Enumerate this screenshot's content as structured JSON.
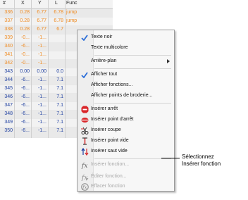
{
  "grid": {
    "headers": [
      "#",
      "X",
      "Y",
      "L",
      "Func"
    ],
    "rows": [
      {
        "cells": [
          "336",
          "0.28",
          "6.77",
          "6.78",
          "jump"
        ],
        "color": "orange"
      },
      {
        "cells": [
          "337",
          "0.28",
          "6.77",
          "6.78",
          "jump"
        ],
        "color": "orange"
      },
      {
        "cells": [
          "338",
          "0.28",
          "6.77",
          "6.7",
          ""
        ],
        "color": "orange"
      },
      {
        "cells": [
          "339",
          "-0...",
          "-1...",
          "",
          ""
        ],
        "color": "orange"
      },
      {
        "cells": [
          "340",
          "-6...",
          "-1...",
          "",
          ""
        ],
        "color": "orange"
      },
      {
        "cells": [
          "341",
          "-0...",
          "-1...",
          "",
          ""
        ],
        "color": "orange"
      },
      {
        "cells": [
          "342",
          "-0...",
          "-1...",
          "",
          ""
        ],
        "color": "orange"
      },
      {
        "cells": [
          "343",
          "0.00",
          "0.00",
          "0.0",
          ""
        ],
        "color": "blue"
      },
      {
        "cells": [
          "344",
          "-6...",
          "-1...",
          "7.1",
          ""
        ],
        "color": "blue"
      },
      {
        "cells": [
          "345",
          "-6...",
          "-1...",
          "7.1",
          ""
        ],
        "color": "blue"
      },
      {
        "cells": [
          "346",
          "-6...",
          "-1...",
          "7.1",
          ""
        ],
        "color": "blue"
      },
      {
        "cells": [
          "347",
          "-6...",
          "-1...",
          "7.1",
          ""
        ],
        "color": "blue"
      },
      {
        "cells": [
          "348",
          "-6...",
          "-1...",
          "7.1",
          ""
        ],
        "color": "blue"
      },
      {
        "cells": [
          "349",
          "-6...",
          "-1...",
          "7.1",
          ""
        ],
        "color": "blue"
      },
      {
        "cells": [
          "350",
          "-6...",
          "-1...",
          "7.1",
          ""
        ],
        "color": "blue"
      }
    ]
  },
  "menu": {
    "items": [
      {
        "label": "Texte noir",
        "checked": true
      },
      {
        "label": "Texte multicolore"
      },
      {
        "label": "Arrière-plan",
        "submenu": true
      },
      {
        "label": "Afficher tout",
        "checked": true
      },
      {
        "label": "Afficher fonctions..."
      },
      {
        "label": "Afficher points de broderie..."
      },
      {
        "label": "Insérer arrêt",
        "icon": "stop-icon"
      },
      {
        "label": "Insérer point d'arrêt",
        "icon": "tie-point-icon"
      },
      {
        "label": "Insérer coupe",
        "icon": "scissors-icon"
      },
      {
        "label": "Insérer point vide",
        "icon": "empty-point-icon"
      },
      {
        "label": "Insérer saut vide",
        "icon": "empty-jump-icon"
      },
      {
        "label": "Insérer fonction...",
        "icon": "insert-function-icon",
        "disabled": true
      },
      {
        "label": "Éditer fonction...",
        "icon": "edit-function-icon",
        "disabled": true
      },
      {
        "label": "Effacer fonction",
        "icon": "delete-function-icon",
        "disabled": true
      }
    ]
  },
  "callout": {
    "line1": "Sélectionnez",
    "line2": "Insérer fonction"
  },
  "colors": {
    "orange": "#ef8a20",
    "blue": "#1e3fa0",
    "stop": "#d9262a"
  }
}
